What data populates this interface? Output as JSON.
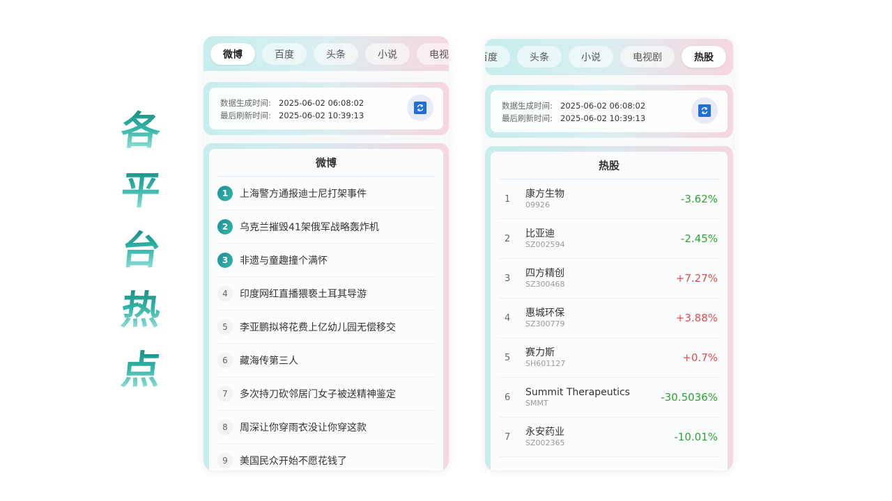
{
  "title_chars": [
    "各",
    "平",
    "台",
    "热",
    "点"
  ],
  "colors": {
    "accent": "#2fb3a6",
    "up": "#e24c4c",
    "down": "#2aa52e"
  },
  "left": {
    "tabs": [
      "微博",
      "百度",
      "头条",
      "小说",
      "电视剧"
    ],
    "active_tab": "微博",
    "info": {
      "gen_label": "数据生成时间:",
      "gen_value": "2025-06-02 06:08:02",
      "refresh_label": "最后刷新时间:",
      "refresh_value": "2025-06-02 10:39:13"
    },
    "list_title": "微博",
    "items": [
      {
        "rank": "1",
        "text": "上海警方通报迪士尼打架事件"
      },
      {
        "rank": "2",
        "text": "乌克兰摧毁41架俄军战略轰炸机"
      },
      {
        "rank": "3",
        "text": "非遗与童趣撞个满怀"
      },
      {
        "rank": "4",
        "text": "印度网红直播猥亵土耳其导游"
      },
      {
        "rank": "5",
        "text": "李亚鹏拟将花费上亿幼儿园无偿移交"
      },
      {
        "rank": "6",
        "text": "藏海传第三人"
      },
      {
        "rank": "7",
        "text": "多次持刀砍邻居门女子被送精神鉴定"
      },
      {
        "rank": "8",
        "text": "周深让你穿雨衣没让你穿这款"
      },
      {
        "rank": "9",
        "text": "美国民众开始不愿花钱了"
      }
    ]
  },
  "right": {
    "tabs": [
      "百度",
      "头条",
      "小说",
      "电视剧",
      "热股"
    ],
    "active_tab": "热股",
    "info": {
      "gen_label": "数据生成时间:",
      "gen_value": "2025-06-02 06:08:02",
      "refresh_label": "最后刷新时间:",
      "refresh_value": "2025-06-02 10:39:13"
    },
    "list_title": "热股",
    "stocks": [
      {
        "rank": "1",
        "name": "康方生物",
        "code": "09926",
        "change": "-3.62%",
        "dir": "down"
      },
      {
        "rank": "2",
        "name": "比亚迪",
        "code": "SZ002594",
        "change": "-2.45%",
        "dir": "down"
      },
      {
        "rank": "3",
        "name": "四方精创",
        "code": "SZ300468",
        "change": "+7.27%",
        "dir": "up"
      },
      {
        "rank": "4",
        "name": "惠城环保",
        "code": "SZ300779",
        "change": "+3.88%",
        "dir": "up"
      },
      {
        "rank": "5",
        "name": "赛力斯",
        "code": "SH601127",
        "change": "+0.7%",
        "dir": "up"
      },
      {
        "rank": "6",
        "name": "Summit Therapeutics",
        "code": "SMMT",
        "change": "-30.5036%",
        "dir": "down"
      },
      {
        "rank": "7",
        "name": "永安药业",
        "code": "SZ002365",
        "change": "-10.01%",
        "dir": "down"
      }
    ]
  }
}
